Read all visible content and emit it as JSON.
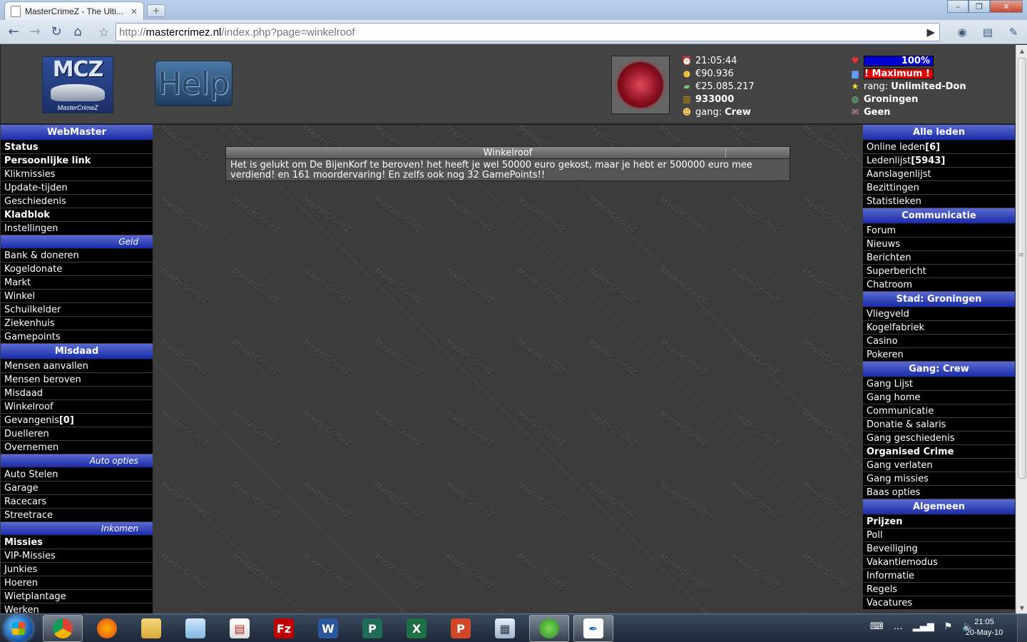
{
  "browser": {
    "tab_title": "MasterCrimeZ - The Ulti...",
    "tab_close": "×",
    "new_tab": "+",
    "url_scheme": "http://",
    "url_host": "mastercrimez.nl",
    "url_path": "/index.php?page=winkelroof",
    "window_minimize": "–",
    "window_maximize": "❐",
    "window_close": "✕"
  },
  "header": {
    "logo_title": "MCZ",
    "logo_sub": "MasterCrimeZ",
    "help_label": "Help",
    "time": "21:05:44",
    "cash": "€90.936",
    "bank": "€25.085.217",
    "bullets": "933000",
    "gang_prefix": "gang: ",
    "gang_name": "Crew",
    "health": "100%",
    "power": "! Maximum !",
    "rank_prefix": "rang: ",
    "rank_name": "Unlimited-Don",
    "city": "Groningen",
    "messages": "Geen"
  },
  "left_nav": {
    "webmaster": {
      "title": "WebMaster",
      "items": [
        "Status",
        "Persoonlijke link",
        "Klikmissies",
        "Update-tijden",
        "Geschiedenis",
        "Kladblok",
        "Instellingen"
      ]
    },
    "geld": {
      "title": "Geld",
      "items": [
        "Bank & doneren",
        "Kogeldonate",
        "Markt",
        "Winkel",
        "Schuilkelder",
        "Ziekenhuis",
        "Gamepoints"
      ]
    },
    "misdaad": {
      "title": "Misdaad",
      "items": [
        "Mensen aanvallen",
        "Mensen beroven",
        "Misdaad",
        "Winkelroof",
        "Gevangenis",
        "Duelleren",
        "Overnemen"
      ],
      "jail_count": "[0]"
    },
    "auto": {
      "title": "Auto opties",
      "items": [
        "Auto Stelen",
        "Garage",
        "Racecars",
        "Streetrace"
      ]
    },
    "inkomen": {
      "title": "Inkomen",
      "items": [
        "Missies",
        "VIP-Missies",
        "Junkies",
        "Hoeren",
        "Wietplantage",
        "Werken"
      ]
    }
  },
  "right_nav": {
    "leden": {
      "title": "Alle leden",
      "items": [
        "Online leden",
        "Ledenlijst",
        "Aanslagenlijst",
        "Bezittingen",
        "Statistieken"
      ],
      "online_count": "[6]",
      "member_count": "[5943]"
    },
    "communicatie": {
      "title": "Communicatie",
      "items": [
        "Forum",
        "Nieuws",
        "Berichten",
        "Superbericht",
        "Chatroom"
      ]
    },
    "stad": {
      "title": "Stad: Groningen",
      "items": [
        "Vliegveld",
        "Kogelfabriek",
        "Casino",
        "Pokeren"
      ]
    },
    "gang": {
      "title": "Gang: Crew",
      "items": [
        "Gang Lijst",
        "Gang home",
        "Communicatie",
        "Donatie & salaris",
        "Gang geschiedenis",
        "Organised Crime",
        "Gang verlaten",
        "Gang missies",
        "Baas opties"
      ]
    },
    "algemeen": {
      "title": "Algemeen",
      "items": [
        "Prijzen",
        "Poll",
        "Beveiliging",
        "Vakantiemodus",
        "Informatie",
        "Regels",
        "Vacatures"
      ]
    }
  },
  "content": {
    "title": "Winkelroof",
    "message": "Het is gelukt om De BijenKorf te beroven! het heeft je wel 50000 euro gekost, maar je hebt er 500000 euro mee verdiend! en 161 moordervaring! En zelfs ook nog 32 GamePoints!!"
  },
  "watermark": "MasterCrimeZ",
  "taskbar": {
    "time": "21:05",
    "date": "20-May-10"
  },
  "colors": {
    "nav_header": "#1a2ba8",
    "nav_item_bg": "#000000",
    "page_bg": "#3c3c3c",
    "health_bar": "#0000cc",
    "power_bar": "#dd0000"
  }
}
